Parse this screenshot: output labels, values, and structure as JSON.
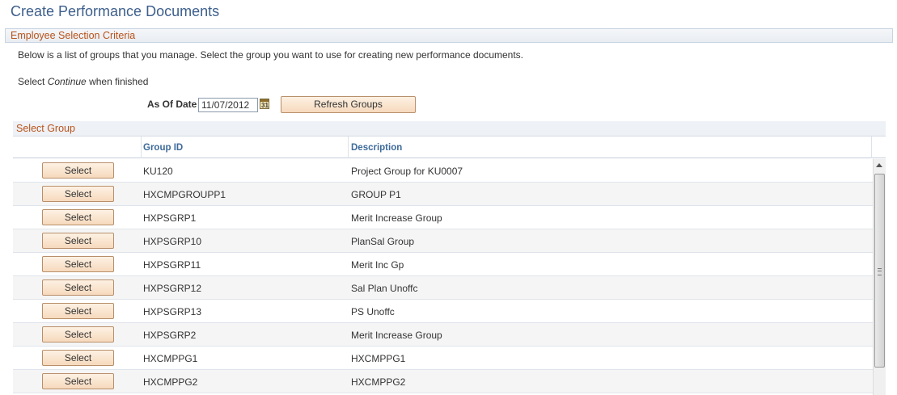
{
  "page": {
    "title": "Create Performance Documents"
  },
  "criteria": {
    "section_title": "Employee Selection Criteria",
    "intro_text": "Below is a list of groups that you manage. Select the group you want to use for creating new performance documents.",
    "instruction_prefix": "Select ",
    "instruction_emphasis": "Continue",
    "instruction_suffix": " when finished",
    "as_of_date_label": "As Of Date",
    "as_of_date_value": "11/07/2012",
    "calendar_icon": "calendar-icon",
    "calendar_glyph": "31",
    "refresh_label": "Refresh Groups"
  },
  "grid": {
    "title": "Select Group",
    "columns": {
      "group_id": "Group ID",
      "description": "Description"
    },
    "rows": [
      {
        "button": "Select",
        "group_id": "KU120",
        "description": "Project Group for KU0007"
      },
      {
        "button": "Select",
        "group_id": "HXCMPGROUPP1",
        "description": "GROUP P1"
      },
      {
        "button": "Select",
        "group_id": "HXPSGRP1",
        "description": "Merit Increase Group"
      },
      {
        "button": "Select",
        "group_id": "HXPSGRP10",
        "description": "PlanSal Group"
      },
      {
        "button": "Select",
        "group_id": "HXPSGRP11",
        "description": "Merit Inc Gp"
      },
      {
        "button": "Select",
        "group_id": "HXPSGRP12",
        "description": "Sal Plan Unoffc"
      },
      {
        "button": "Select",
        "group_id": "HXPSGRP13",
        "description": "PS Unoffc"
      },
      {
        "button": "Select",
        "group_id": "HXPSGRP2",
        "description": "Merit Increase Group"
      },
      {
        "button": "Select",
        "group_id": "HXCMPPG1",
        "description": "HXCMPPG1"
      },
      {
        "button": "Select",
        "group_id": "HXCMPPG2",
        "description": "HXCMPPG2"
      }
    ]
  },
  "colors": {
    "title": "#3d5f8c",
    "section_title": "#b9531b",
    "column_header": "#3d6a9a",
    "button_fill": "#f6d9bd"
  }
}
